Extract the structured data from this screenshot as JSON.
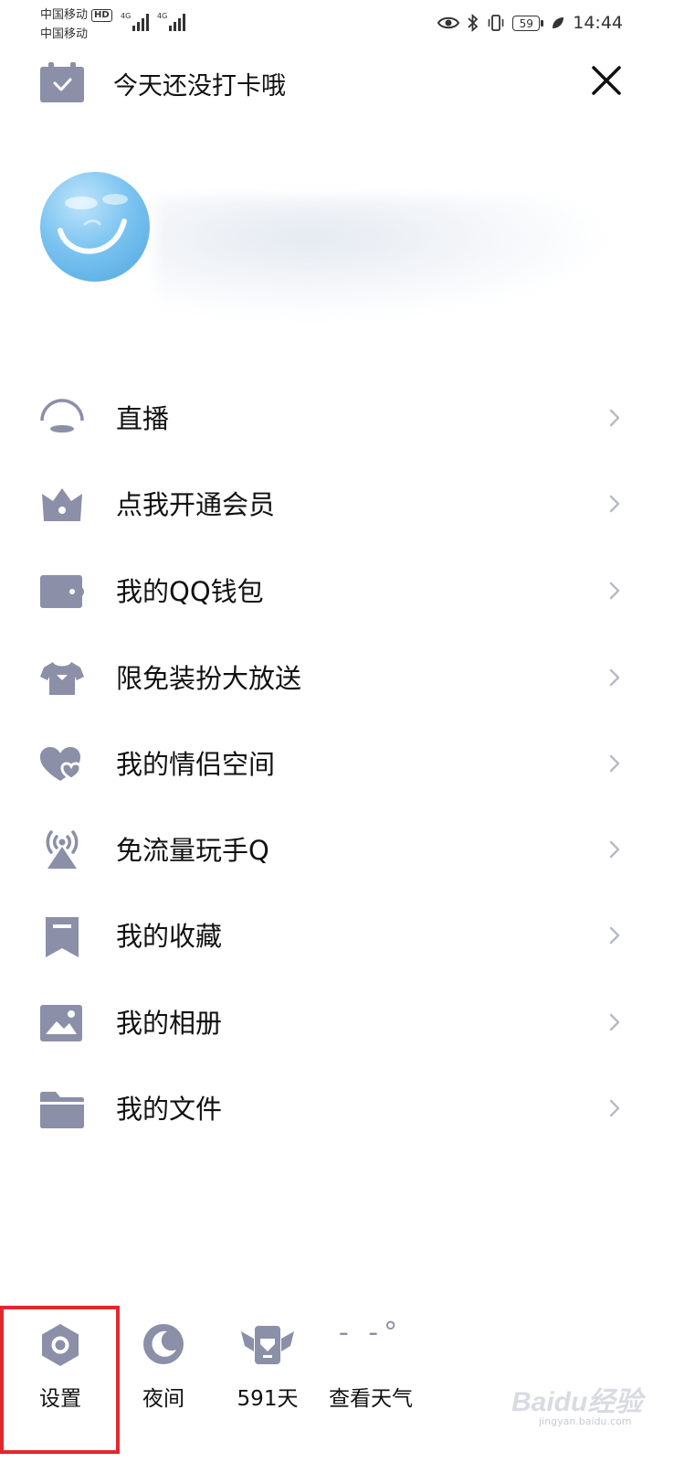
{
  "status_bar": {
    "carrier_1": "中国移动",
    "hd_badge": "HD",
    "carrier_2": "中国移动",
    "net_type_1": "4G",
    "net_type_2": "4G",
    "battery": "59",
    "time": "14:44"
  },
  "header": {
    "checkin_text": "今天还没打卡哦"
  },
  "menu": {
    "items": [
      {
        "label": "直播",
        "icon": "live-icon"
      },
      {
        "label": "点我开通会员",
        "icon": "vip-crown-icon"
      },
      {
        "label": "我的QQ钱包",
        "icon": "wallet-icon"
      },
      {
        "label": "限免装扮大放送",
        "icon": "tshirt-icon"
      },
      {
        "label": "我的情侣空间",
        "icon": "couple-hearts-icon"
      },
      {
        "label": "免流量玩手Q",
        "icon": "antenna-icon"
      },
      {
        "label": "我的收藏",
        "icon": "bookmark-icon"
      },
      {
        "label": "我的相册",
        "icon": "image-icon"
      },
      {
        "label": "我的文件",
        "icon": "folder-icon"
      }
    ]
  },
  "bottom_bar": {
    "settings_label": "设置",
    "night_label": "夜间",
    "days_label": "591天",
    "weather_label": "查看天气",
    "weather_icon_text": "- -°"
  },
  "watermark": {
    "text": "Baidu经验",
    "sub": "jingyan.baidu.com"
  },
  "colors": {
    "icon_gray": "#8b8fa8",
    "highlight_red": "#e0282e"
  }
}
